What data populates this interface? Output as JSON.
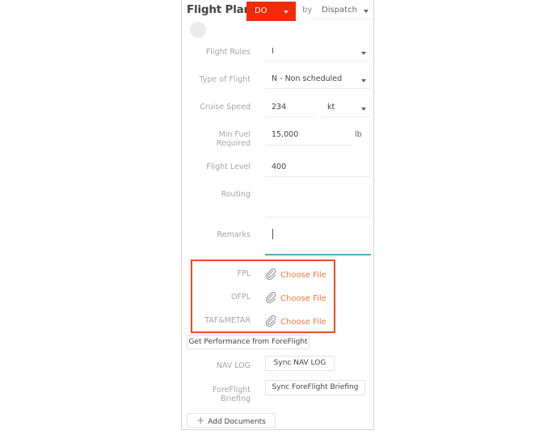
{
  "header": {
    "title": "Flight Plan",
    "status_select": "DO",
    "by_label": "by",
    "by_select": "Dispatch"
  },
  "colors": {
    "status_bg": "#f22a0a",
    "link": "#f2773f",
    "highlight_box": "#f24a1c",
    "focus_underline": "#5aa6c4"
  },
  "fields": {
    "flight_rules": {
      "label": "Flight Rules",
      "value": "I"
    },
    "type_of_flight": {
      "label": "Type of Flight",
      "value": "N - Non scheduled"
    },
    "cruise_speed": {
      "label": "Cruise Speed",
      "value": "234",
      "unit": "kt"
    },
    "min_fuel": {
      "label_line1": "Min Fuel",
      "label_line2": "Required",
      "value": "15,000",
      "unit": "lb"
    },
    "flight_level": {
      "label": "Flight Level",
      "value": "400"
    },
    "routing": {
      "label": "Routing",
      "value": ""
    },
    "remarks": {
      "label": "Remarks",
      "value": ""
    }
  },
  "attachments": [
    {
      "label": "FPL",
      "action": "Choose File",
      "icon": "paperclip-icon"
    },
    {
      "label": "OFPL",
      "action": "Choose File",
      "icon": "paperclip-icon"
    },
    {
      "label": "TAF&METAR",
      "action": "Choose File",
      "icon": "paperclip-icon"
    }
  ],
  "actions": {
    "get_performance": "Get Performance from ForeFlight",
    "nav_log_label": "NAV LOG",
    "sync_nav_log": "Sync NAV LOG",
    "foreflight_label_line1": "ForeFlight",
    "foreflight_label_line2": "Briefing",
    "sync_foreflight": "Sync ForeFlight Briefing",
    "add_documents": "Add Documents",
    "add_icon": "+"
  }
}
